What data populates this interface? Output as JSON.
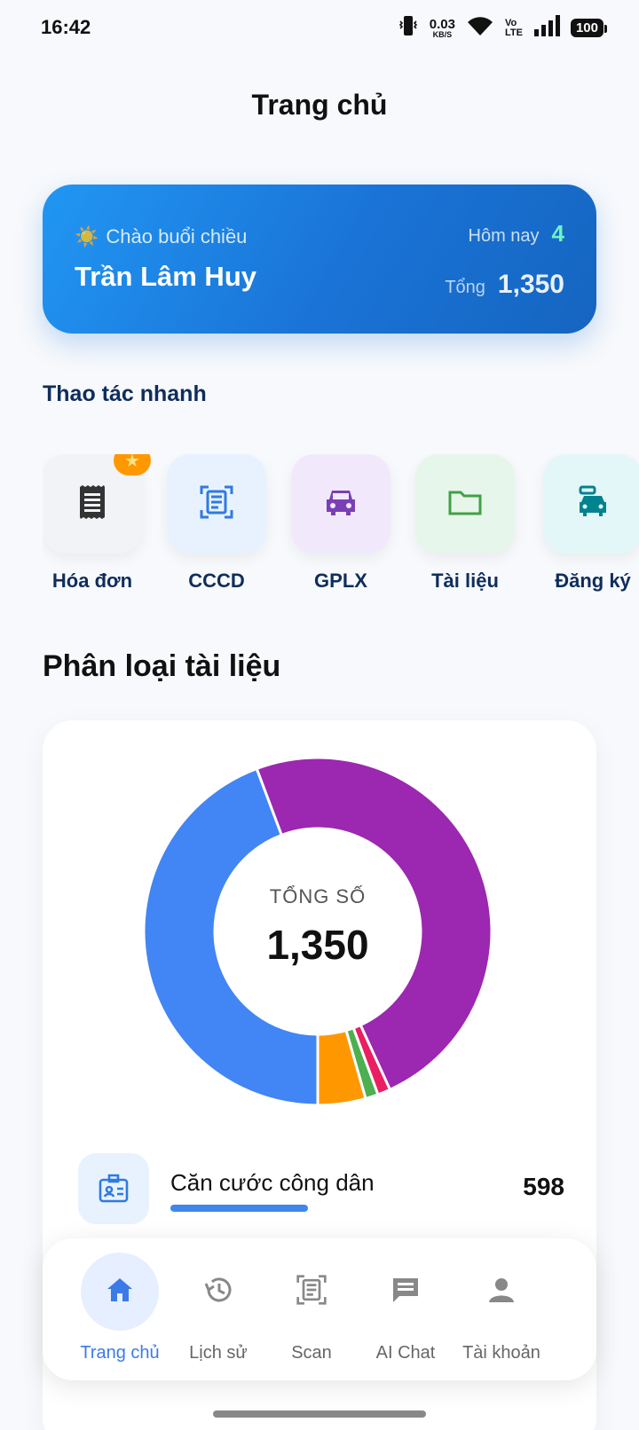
{
  "status_bar": {
    "time": "16:42",
    "net_speed": "0.03",
    "net_unit": "KB/S",
    "volte_top": "Vo",
    "volte_bottom": "LTE",
    "battery": "100"
  },
  "header": {
    "title": "Trang chủ"
  },
  "greeting": {
    "label": "Chào buổi chiều",
    "icon": "sun-icon",
    "name": "Trần Lâm Huy",
    "today_label": "Hôm nay",
    "today_value": "4",
    "total_label": "Tổng",
    "total_value": "1,350"
  },
  "quick_actions": {
    "title": "Thao tác nhanh",
    "items": [
      {
        "label": "Hóa đơn",
        "icon": "receipt-icon",
        "bg": "#f1f3f6",
        "color": "#333333",
        "badge": "star-icon"
      },
      {
        "label": "CCCD",
        "icon": "scan-document-icon",
        "bg": "#e8f2ff",
        "color": "#2f7be0"
      },
      {
        "label": "GPLX",
        "icon": "car-icon",
        "bg": "#f1e9fb",
        "color": "#7b3fb5"
      },
      {
        "label": "Tài liệu",
        "icon": "folder-icon",
        "bg": "#e6f6ea",
        "color": "#43a047"
      },
      {
        "label": "Đăng ký",
        "icon": "car-registration-icon",
        "bg": "#e4f7f8",
        "color": "#00838f"
      }
    ]
  },
  "categories": {
    "title": "Phân loại tài liệu",
    "center_label": "TỔNG SỐ",
    "center_value": "1,350",
    "rows": [
      {
        "name": "Căn cước công dân",
        "count": "598",
        "icon": "id-card-icon",
        "bar_color": "#3f86ec",
        "bar_fraction": 0.443
      },
      {
        "name": "",
        "count": "",
        "icon": "receipt-icon",
        "bar_color": "#9c27b0",
        "bar_fraction": 0.49
      }
    ]
  },
  "chart_data": {
    "type": "pie",
    "title": "",
    "categories": [
      "Căn cước công dân",
      "",
      "",
      "",
      ""
    ],
    "values": [
      598,
      660,
      16,
      16,
      60
    ],
    "colors": [
      "#4285f4",
      "#9c27b0",
      "#e91e63",
      "#4caf50",
      "#ff9800"
    ],
    "total": "1,350"
  },
  "bottom_nav": {
    "items": [
      {
        "label": "Trang chủ",
        "icon": "home-icon",
        "active": true
      },
      {
        "label": "Lịch sử",
        "icon": "history-icon",
        "active": false
      },
      {
        "label": "Scan",
        "icon": "scan-icon",
        "active": false
      },
      {
        "label": "AI Chat",
        "icon": "chat-icon",
        "active": false
      },
      {
        "label": "Tài khoản",
        "icon": "account-icon",
        "active": false
      }
    ]
  }
}
